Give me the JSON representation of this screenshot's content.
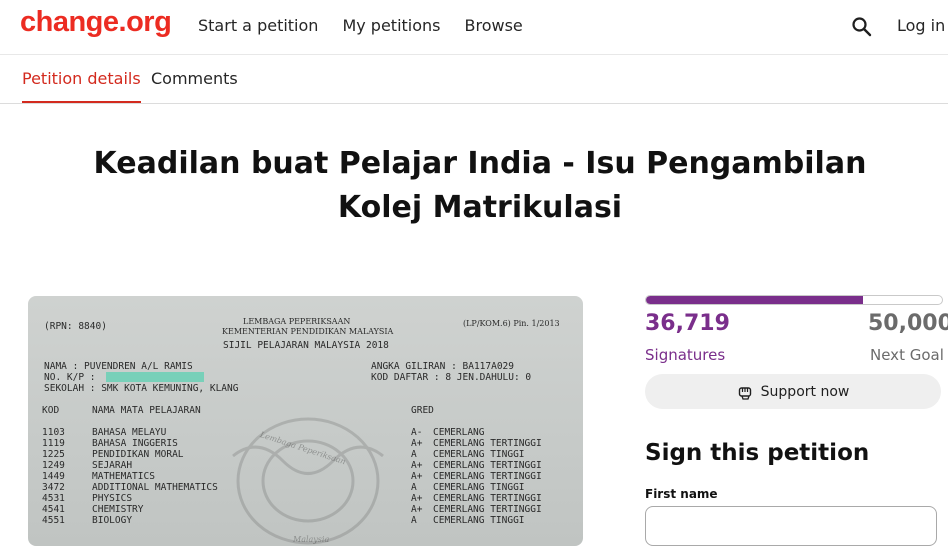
{
  "header": {
    "logo": "change.org",
    "nav": [
      "Start a petition",
      "My petitions",
      "Browse"
    ],
    "search_icon": "search-icon",
    "login": "Log in"
  },
  "tabs": {
    "active": "Petition details",
    "other": "Comments"
  },
  "petition": {
    "title": "Keadilan buat Pelajar India - Isu Pengambilan Kolej Matrikulasi",
    "image": {
      "rpn": "(RPN:  8840)",
      "form_code": "(LP/KOM.6) Pin. 1/2013",
      "org": "LEMBAGA PEPERIKSAAN",
      "ministry": "KEMENTERIAN PENDIDIKAN MALAYSIA",
      "cert": "SIJIL PELAJARAN MALAYSIA 2018",
      "nama": "NAMA : PUVENDREN A/L RAMIS",
      "nokp": "NO. K/P :",
      "sekolah": "SEKOLAH : SMK KOTA KEMUNING, KLANG",
      "angka": "ANGKA GILIRAN : BA117A029",
      "kod_daftar": "KOD DAFTAR : 8 JEN.DAHULU: 0",
      "col_kod": "KOD",
      "col_subject": "NAMA MATA PELAJARAN",
      "col_gred": "GRED",
      "watermark": "Lembaga Peperiksaan",
      "watermark2": "Malaysia",
      "rows": [
        {
          "kod": "1103",
          "subject": "BAHASA MELAYU",
          "grade": "A-",
          "desc": "CEMERLANG"
        },
        {
          "kod": "1119",
          "subject": "BAHASA INGGERIS",
          "grade": "A+",
          "desc": "CEMERLANG TERTINGGI"
        },
        {
          "kod": "1225",
          "subject": "PENDIDIKAN MORAL",
          "grade": "A",
          "desc": "CEMERLANG TINGGI"
        },
        {
          "kod": "1249",
          "subject": "SEJARAH",
          "grade": "A+",
          "desc": "CEMERLANG TERTINGGI"
        },
        {
          "kod": "1449",
          "subject": "MATHEMATICS",
          "grade": "A+",
          "desc": "CEMERLANG TERTINGGI"
        },
        {
          "kod": "3472",
          "subject": "ADDITIONAL MATHEMATICS",
          "grade": "A",
          "desc": "CEMERLANG TINGGI"
        },
        {
          "kod": "4531",
          "subject": "PHYSICS",
          "grade": "A+",
          "desc": "CEMERLANG TERTINGGI"
        },
        {
          "kod": "4541",
          "subject": "CHEMISTRY",
          "grade": "A+",
          "desc": "CEMERLANG TERTINGGI"
        },
        {
          "kod": "4551",
          "subject": "BIOLOGY",
          "grade": "A",
          "desc": "CEMERLANG TINGGI"
        }
      ]
    }
  },
  "signatures": {
    "count": "36,719",
    "count_label": "Signatures",
    "goal": "50,000",
    "goal_label": "Next Goal",
    "progress_fraction": 0.7344
  },
  "support_button": {
    "label": "Support now",
    "icon": "fist-icon"
  },
  "sign_form": {
    "title": "Sign this petition",
    "first_name_label": "First name",
    "first_name_value": ""
  },
  "colors": {
    "brand": "#ec2c22",
    "accent_purple": "#7a2e8b",
    "tab_active": "#d32a1e"
  }
}
